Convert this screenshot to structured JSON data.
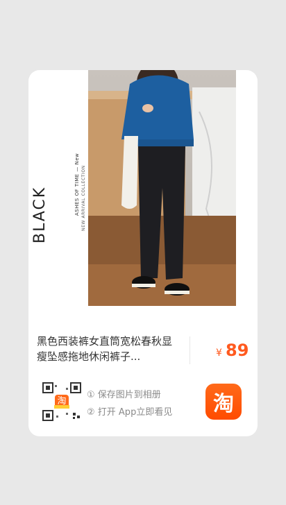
{
  "product": {
    "title": "黑色西装裤女直筒宽松春秋显瘦坠感拖地休闲裤子...",
    "currency": "¥",
    "price": "89",
    "image_brand": "BLACK",
    "image_tag_1": "ASHES OF TIME — New",
    "image_tag_2": "NEW ARRIVAL COLLECTION"
  },
  "qr": {
    "badge_text": "淘"
  },
  "steps": {
    "step1": "① 保存图片到相册",
    "step2": "② 打开 App立即看见"
  },
  "app": {
    "icon_glyph": "淘",
    "accent_color": "#ff5a1f"
  }
}
